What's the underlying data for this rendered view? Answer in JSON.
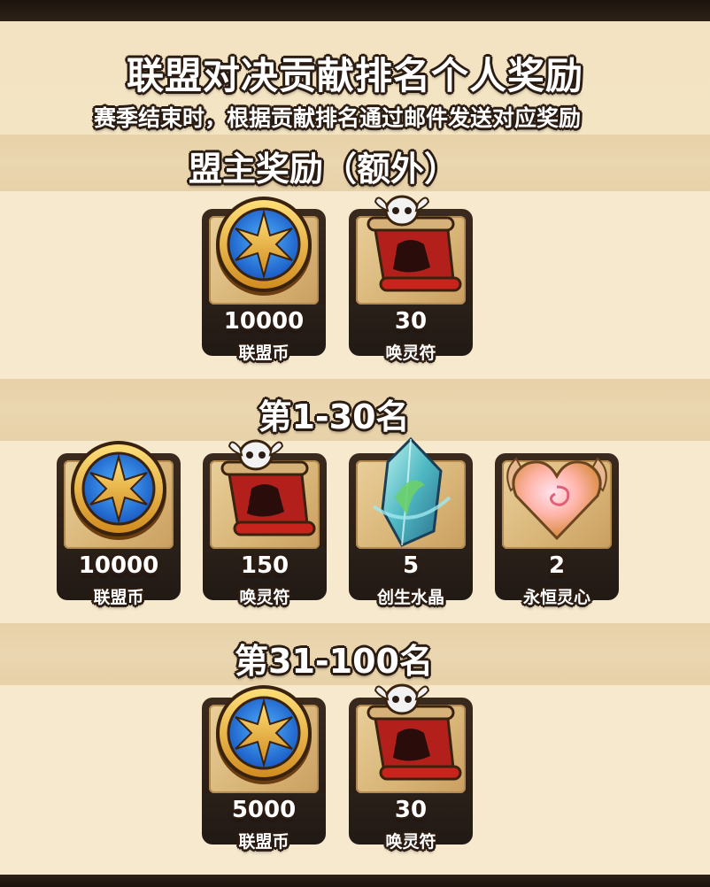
{
  "header": {
    "title": "联盟对决贡献排名个人奖励",
    "subtitle": "赛季结束时，根据贡献排名通过邮件发送对应奖励"
  },
  "sections": [
    {
      "heading": "盟主奖励（额外）",
      "rewards": [
        {
          "icon": "alliance-coin-icon",
          "qty": "10000",
          "name": "联盟币"
        },
        {
          "icon": "summon-scroll-icon",
          "qty": "30",
          "name": "唤灵符"
        }
      ]
    },
    {
      "heading": "第1-30名",
      "rewards": [
        {
          "icon": "alliance-coin-icon",
          "qty": "10000",
          "name": "联盟币"
        },
        {
          "icon": "summon-scroll-icon",
          "qty": "150",
          "name": "唤灵符"
        },
        {
          "icon": "genesis-crystal-icon",
          "qty": "5",
          "name": "创生水晶"
        },
        {
          "icon": "eternal-heart-icon",
          "qty": "2",
          "name": "永恒灵心"
        }
      ]
    },
    {
      "heading": "第31-100名",
      "rewards": [
        {
          "icon": "alliance-coin-icon",
          "qty": "5000",
          "name": "联盟币"
        },
        {
          "icon": "summon-scroll-icon",
          "qty": "30",
          "name": "唤灵符"
        }
      ]
    }
  ],
  "colors": {
    "parchment": "#f4e6c7",
    "band": "#e8d3ac",
    "card_frame": "#2b1e15"
  }
}
